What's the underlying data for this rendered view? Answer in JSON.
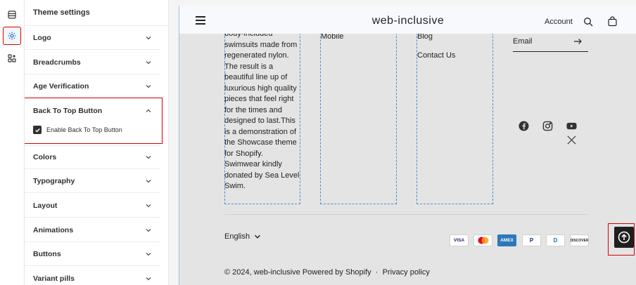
{
  "panel": {
    "title": "Theme settings",
    "sections": [
      {
        "label": "Logo"
      },
      {
        "label": "Breadcrumbs"
      },
      {
        "label": "Age Verification"
      },
      {
        "label": "Back To Top Button"
      },
      {
        "label": "Colors"
      },
      {
        "label": "Typography"
      },
      {
        "label": "Layout"
      },
      {
        "label": "Animations"
      },
      {
        "label": "Buttons"
      },
      {
        "label": "Variant pills"
      }
    ],
    "back_to_top": {
      "checkbox_label": "Enable Back To Top Button",
      "checked": true
    }
  },
  "preview": {
    "brand": "web-inclusive",
    "account_label": "Account",
    "column_text": "body-included swimsuits made from regenerated nylon. The result is a beautiful line up of luxurious high quality pieces that feel right for the times and designed to last.This is a demonstration of the Showcase theme for Shopify. Swimwear kindly donated by Sea Level Swim.",
    "links_col2": [
      "Mobile"
    ],
    "links_col3": [
      "Blog",
      "Contact Us"
    ],
    "email_label": "Email",
    "language": "English",
    "payments": [
      "VISA",
      "MC",
      "AMEX",
      "P",
      "D",
      "DISCOVER"
    ],
    "copyright": "© 2024, web-inclusive Powered by Shopify",
    "privacy": "Privacy policy"
  },
  "colors": {
    "highlight": "#d90000",
    "accent": "#2c6ecb",
    "preview_bg": "#e4e4e4"
  }
}
